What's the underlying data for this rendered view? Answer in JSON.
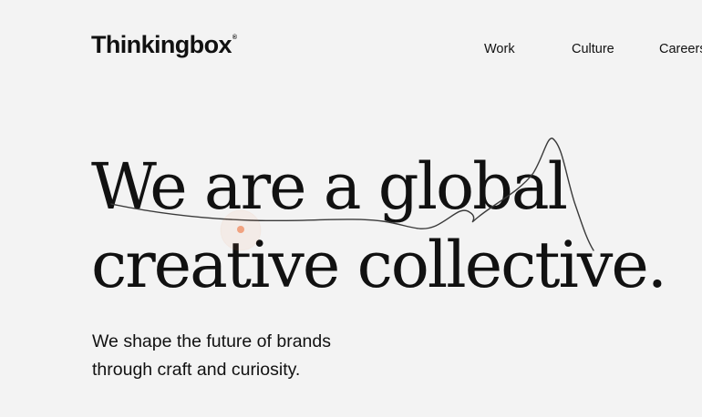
{
  "header": {
    "logo_text": "Thinkingbox",
    "logo_mark": "®",
    "nav": [
      {
        "label": "Work"
      },
      {
        "label": "Culture"
      },
      {
        "label": "Careers"
      }
    ]
  },
  "hero": {
    "headline_line1": "We are a global",
    "headline_line2": "creative collective.",
    "subtitle_line1": "We shape the future of brands",
    "subtitle_line2": "through craft and curiosity."
  },
  "colors": {
    "background": "#f3f3f3",
    "text": "#111111",
    "scribble": "#3a3a3a",
    "cursor_dot": "#f08a5d"
  }
}
